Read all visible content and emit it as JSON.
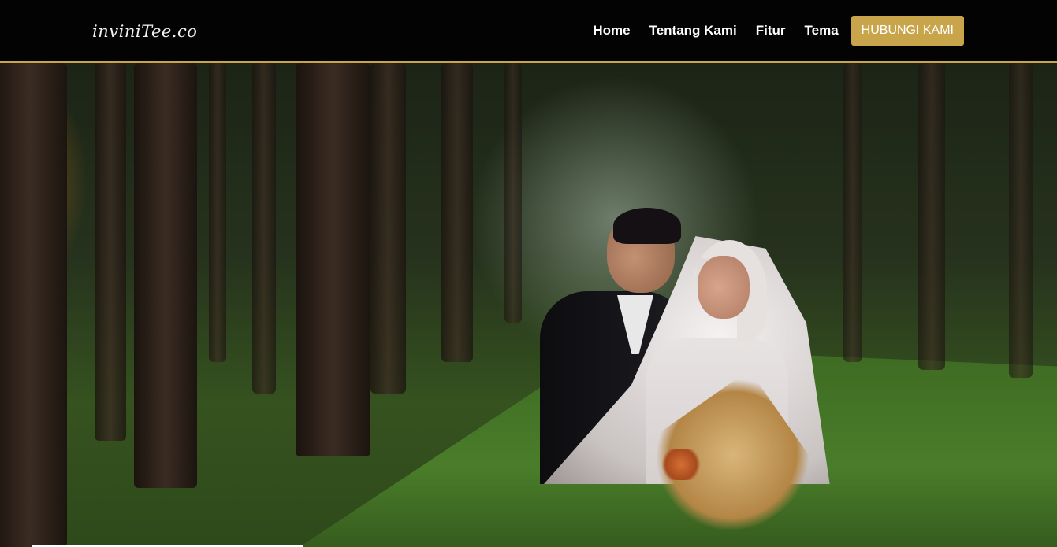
{
  "logo": {
    "text": "inviniTee.co"
  },
  "nav": {
    "links": [
      {
        "label": "Home"
      },
      {
        "label": "Tentang Kami"
      },
      {
        "label": "Fitur"
      },
      {
        "label": "Tema"
      }
    ],
    "cta_label": "HUBUNGI KAMI"
  },
  "colors": {
    "navbar_bg": "#030303",
    "accent_gold": "#c8a54b",
    "nav_text": "#ffffff"
  },
  "hero": {
    "image": "wedding-couple-forest-photo"
  }
}
